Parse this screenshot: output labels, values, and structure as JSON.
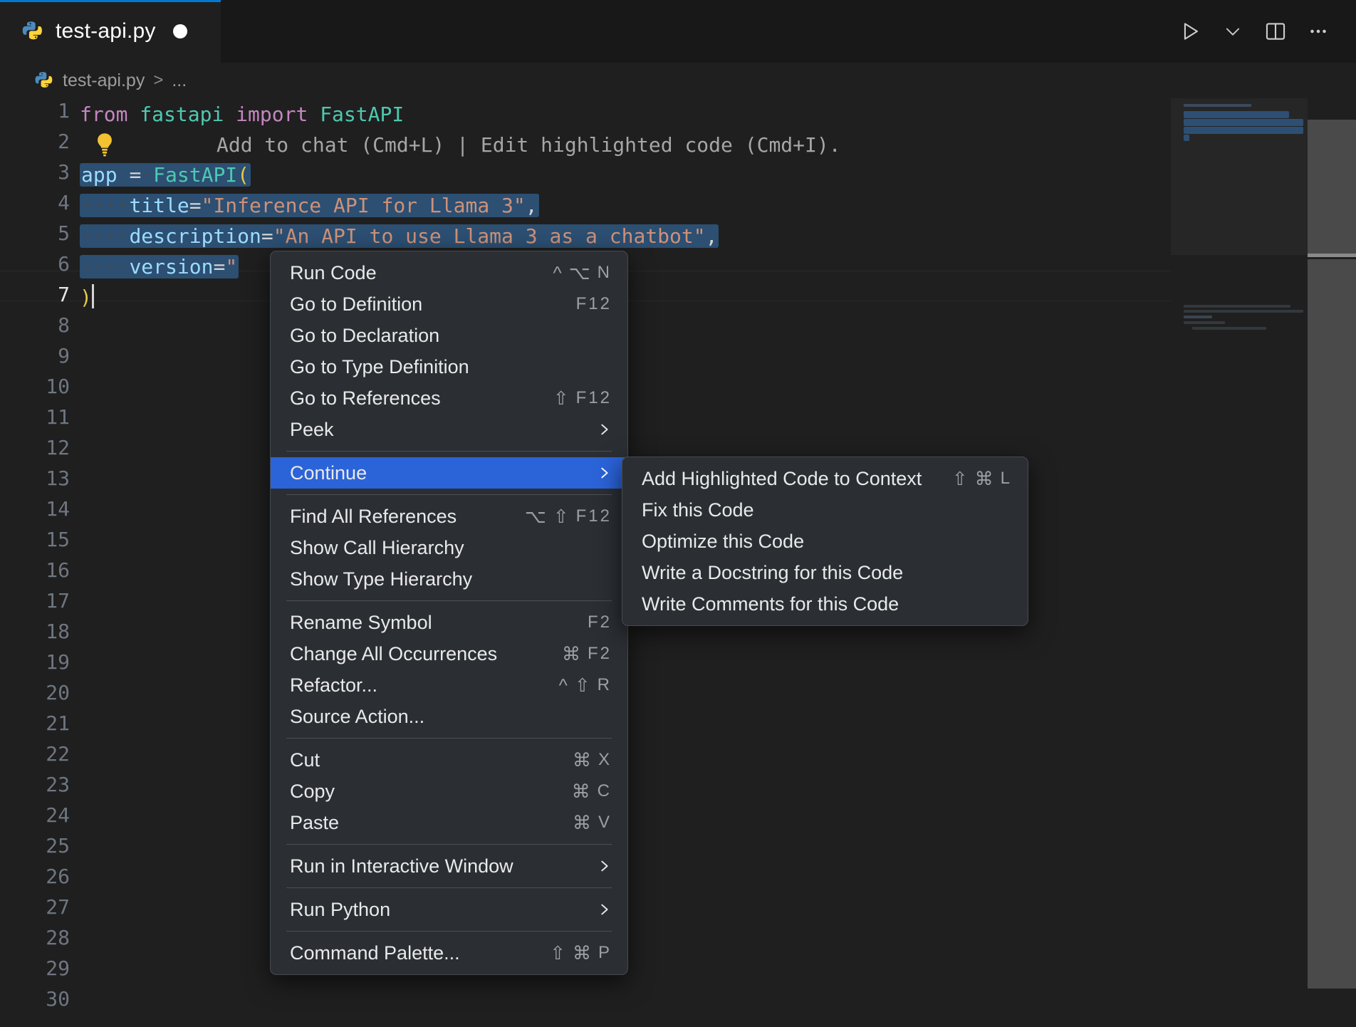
{
  "window": {
    "accent_color": "#0078d4",
    "editor_bg": "#1f1f1f",
    "tabbar_bg": "#181818",
    "menu_bg": "#2b2f33",
    "menu_selected_bg": "#2b63d9",
    "selection_bg": "#2c4f72"
  },
  "tab": {
    "icon": "python-file-icon",
    "label": "test-api.py",
    "dirty": true,
    "dirty_indicator": "unsaved-changes-dot"
  },
  "tab_actions": [
    {
      "name": "run-python-file-button",
      "icon": "play-icon"
    },
    {
      "name": "run-options-dropdown",
      "icon": "chevron-down-icon"
    },
    {
      "name": "split-editor-right-button",
      "icon": "split-editor-icon"
    },
    {
      "name": "more-actions-button",
      "icon": "ellipsis-icon"
    }
  ],
  "breadcrumb": {
    "icon": "python-file-icon",
    "file": "test-api.py",
    "separator": ">",
    "overflow": "..."
  },
  "editor": {
    "line_numbers": [
      1,
      2,
      3,
      4,
      5,
      6,
      7,
      8,
      9,
      10,
      11,
      12,
      13,
      14,
      15,
      16,
      17,
      18,
      19,
      20,
      21,
      22,
      23,
      24,
      25,
      26,
      27,
      28,
      29,
      30
    ],
    "active_line": 7,
    "inline_hint": {
      "icon": "lightbulb-icon",
      "text": "Add to chat (Cmd+L) | Edit highlighted code (Cmd+I)."
    },
    "code": {
      "line1": {
        "kw": "from",
        "mod": "fastapi",
        "kw2": "import",
        "cls": "FastAPI"
      },
      "line3": {
        "var": "app",
        "op": "=",
        "cls": "FastAPI",
        "paren": "("
      },
      "line4": {
        "arg": "title",
        "op": "=",
        "value": "\"Inference API for Llama 3\"",
        "comma": ","
      },
      "line5": {
        "arg": "description",
        "op": "=",
        "value": "\"An API to use Llama 3 as a chatbot\"",
        "comma": ","
      },
      "line6": {
        "arg": "version",
        "op": "=",
        "value": "\""
      },
      "line7": {
        "paren": ")"
      }
    }
  },
  "context_menu": {
    "name": "editor-context-menu",
    "groups": [
      {
        "items": [
          {
            "label": "Run Code",
            "kbd": [
              "^",
              "⌥",
              "N"
            ],
            "submenu": false
          },
          {
            "label": "Go to Definition",
            "kbd": [
              "F12"
            ],
            "submenu": false
          },
          {
            "label": "Go to Declaration",
            "kbd": [],
            "submenu": false
          },
          {
            "label": "Go to Type Definition",
            "kbd": [],
            "submenu": false
          },
          {
            "label": "Go to References",
            "kbd": [
              "⇧",
              "F12"
            ],
            "submenu": false
          },
          {
            "label": "Peek",
            "kbd": [],
            "submenu": true
          }
        ]
      },
      {
        "items": [
          {
            "label": "Continue",
            "kbd": [],
            "submenu": true,
            "selected": true
          }
        ]
      },
      {
        "items": [
          {
            "label": "Find All References",
            "kbd": [
              "⌥",
              "⇧",
              "F12"
            ],
            "submenu": false
          },
          {
            "label": "Show Call Hierarchy",
            "kbd": [],
            "submenu": false
          },
          {
            "label": "Show Type Hierarchy",
            "kbd": [],
            "submenu": false
          }
        ]
      },
      {
        "items": [
          {
            "label": "Rename Symbol",
            "kbd": [
              "F2"
            ],
            "submenu": false
          },
          {
            "label": "Change All Occurrences",
            "kbd": [
              "⌘",
              "F2"
            ],
            "submenu": false
          },
          {
            "label": "Refactor...",
            "kbd": [
              "^",
              "⇧",
              "R"
            ],
            "submenu": false
          },
          {
            "label": "Source Action...",
            "kbd": [],
            "submenu": false
          }
        ]
      },
      {
        "items": [
          {
            "label": "Cut",
            "kbd": [
              "⌘",
              "X"
            ],
            "submenu": false
          },
          {
            "label": "Copy",
            "kbd": [
              "⌘",
              "C"
            ],
            "submenu": false
          },
          {
            "label": "Paste",
            "kbd": [
              "⌘",
              "V"
            ],
            "submenu": false
          }
        ]
      },
      {
        "items": [
          {
            "label": "Run in Interactive Window",
            "kbd": [],
            "submenu": true
          }
        ]
      },
      {
        "items": [
          {
            "label": "Run Python",
            "kbd": [],
            "submenu": true
          }
        ]
      },
      {
        "items": [
          {
            "label": "Command Palette...",
            "kbd": [
              "⇧",
              "⌘",
              "P"
            ],
            "submenu": false
          }
        ]
      }
    ]
  },
  "submenu": {
    "name": "continue-submenu",
    "items": [
      {
        "label": "Add Highlighted Code to Context",
        "kbd": [
          "⇧",
          "⌘",
          "L"
        ]
      },
      {
        "label": "Fix this Code",
        "kbd": []
      },
      {
        "label": "Optimize this Code",
        "kbd": []
      },
      {
        "label": "Write a Docstring for this Code",
        "kbd": []
      },
      {
        "label": "Write Comments for this Code",
        "kbd": []
      }
    ]
  }
}
